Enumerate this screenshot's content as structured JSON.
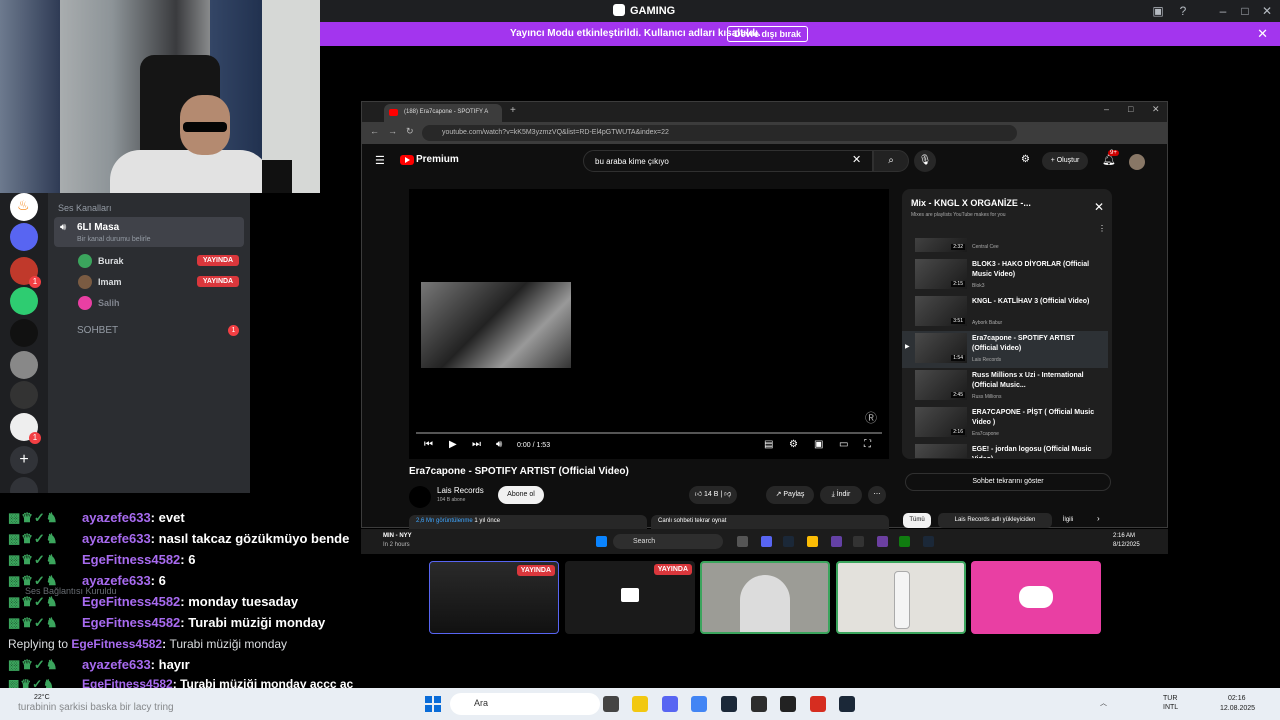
{
  "app": {
    "title": "GAMING"
  },
  "banner": {
    "message": "Yayıncı Modu etkinleştirildi. Kullanıcı adları kısaltıldı.",
    "button": "Devre dışı bırak"
  },
  "channels": {
    "category": "Ses Kanalları",
    "voice_channel": {
      "name": "6LI Masa",
      "status": "Bir kanal durumu belirle"
    },
    "users": [
      {
        "name": "Burak",
        "badge": "YAYINDA"
      },
      {
        "name": "Imam",
        "badge": "YAYINDA"
      },
      {
        "name": "Salih",
        "badge": ""
      }
    ],
    "text_channel": {
      "name": "SOHBET",
      "count": "1"
    }
  },
  "chat": {
    "lines": [
      {
        "name": "ayazefe633",
        "text": "evet"
      },
      {
        "name": "ayazefe633",
        "text": "nasıl takcaz gözükmüyo bende"
      },
      {
        "name": "EgeFitness4582",
        "text": "6"
      },
      {
        "name": "ayazefe633",
        "text": "6"
      },
      {
        "name": "EgeFitness4582",
        "text": "monday tuesaday"
      },
      {
        "name": "EgeFitness4582",
        "text": "Turabi müziği monday"
      },
      {
        "name": "ayazefe633",
        "text": "hayır"
      },
      {
        "name": "EgeFitness4582",
        "text": "Turabi müziği monday accc ac"
      }
    ],
    "reply_prefix": "Replying to",
    "reply_name": "EgeFitness4582",
    "reply_text": "Turabi müziği monday",
    "voice_status": "Ses Bağlantısı Kuruldu",
    "bottom_text": "turabinin şarkisi baska bir lacy tring"
  },
  "browser": {
    "tab_title": "(188) Era7capone - SPOTIFY A",
    "url": "youtube.com/watch?v=kK5M3yzmzVQ&list=RD-El4pGTWUTA&index=22",
    "search_query": "bu araba kime çıkıyo",
    "premium": "Premium",
    "create": "Oluştur",
    "notif_count": "9+",
    "video": {
      "title": "Era7capone - SPOTIFY ARTIST (Official Video)",
      "channel": "Lais Records",
      "subscribers": "104 B abone",
      "subscribe": "Abone ol",
      "likes": "14 B",
      "share": "Paylaş",
      "download": "İndir",
      "time": "0:00 / 1:53",
      "views": "2,6 Mn görüntülenme",
      "ago": "1 yıl önce",
      "live_chat": "Canlı sohbeti tekrar oynat"
    },
    "playlist": {
      "title": "Mix - KNGL X ORGANİZE -...",
      "subtitle": "Mixes are playlists YouTube makes for you",
      "items": [
        {
          "title": "",
          "channel": "Central Cee",
          "duration": "2:32"
        },
        {
          "title": "BLOK3 - HAKO DİYORLAR (Official Music Video)",
          "channel": "Blok3",
          "duration": "2:15"
        },
        {
          "title": "KNGL - KATLİHAV 3 (Official Video)",
          "channel": "Aybork Babur",
          "duration": "3:51"
        },
        {
          "title": "Era7capone - SPOTIFY ARTIST (Official Video)",
          "channel": "Lais Records",
          "duration": "1:54"
        },
        {
          "title": "Russ Millions x Uzi - International (Official Music...",
          "channel": "Russ Millions",
          "duration": "2:45"
        },
        {
          "title": "ERA7CAPONE - PİŞT ( Official Music Video )",
          "channel": "Era7capone",
          "duration": "2:16"
        },
        {
          "title": "EGE! - jordan logosu (Official Music Video)",
          "channel": "",
          "duration": ""
        }
      ],
      "replay_button": "Sohbet tekrarını göster",
      "chips": [
        "Tümü",
        "Lais Records adlı yükleyiciden",
        "İlgili"
      ]
    }
  },
  "inner_taskbar": {
    "ticker": "MIN - NYY",
    "ticker_sub": "In 2 hours",
    "search": "Search",
    "time": "2:16 AM",
    "date": "8/12/2025"
  },
  "streams": [
    {
      "label": "YAYINDA"
    },
    {
      "label": "YAYINDA"
    }
  ],
  "taskbar": {
    "weather": "22°C",
    "search": "Ara",
    "lang": "TUR",
    "lang_sub": "INTL",
    "time": "02:16",
    "date": "12.08.2025"
  },
  "colors": {
    "banner": "#a335ee",
    "live": "#da373c",
    "discord_pink": "#e93fa3"
  }
}
